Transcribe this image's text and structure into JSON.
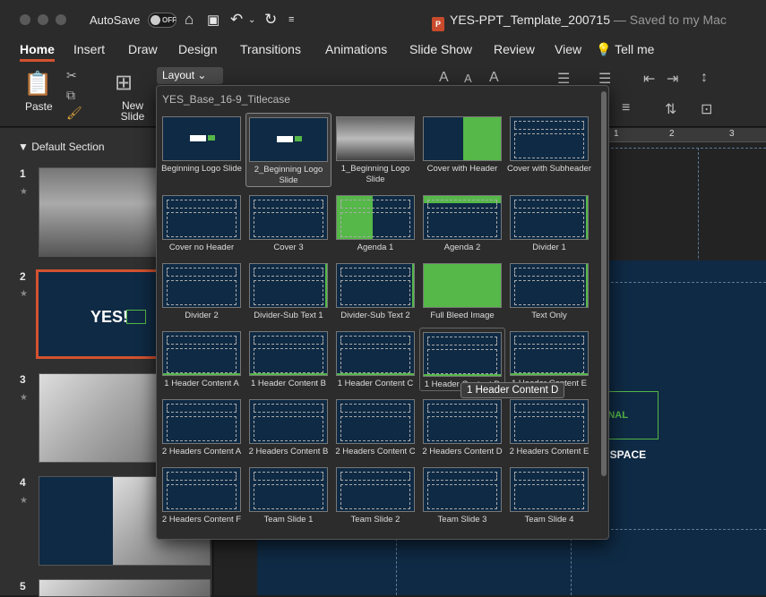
{
  "titlebar": {
    "autosave_label": "AutoSave",
    "autosave_state": "OFF",
    "doc_name": "YES-PPT_Template_200715",
    "saved_text": "— Saved to my Mac"
  },
  "tabs": [
    "Home",
    "Insert",
    "Draw",
    "Design",
    "Transitions",
    "Animations",
    "Slide Show",
    "Review",
    "View",
    "Tell me"
  ],
  "ribbon": {
    "paste_label": "Paste",
    "new_slide_label": "New Slide",
    "layout_label": "Layout"
  },
  "sidebar": {
    "section_label": "Default Section",
    "slide_numbers": [
      "1",
      "2",
      "3",
      "4",
      "5"
    ]
  },
  "ruler": {
    "ticks": [
      "1",
      "2",
      "3"
    ]
  },
  "slide_text": {
    "word1": "TIONAL",
    "word2": "T SPACE"
  },
  "gallery": {
    "title": "YES_Base_16-9_Titlecase",
    "layouts": [
      "Beginning Logo Slide",
      "2_Beginning Logo Slide",
      "1_Beginning Logo Slide",
      "Cover with Header",
      "Cover with Subheader",
      "Cover no Header",
      "Cover 3",
      "Agenda 1",
      "Agenda 2",
      "Divider 1",
      "Divider 2",
      "Divider-Sub Text 1",
      "Divider-Sub Text 2",
      "Full Bleed Image",
      "Text Only",
      "1 Header Content A",
      "1 Header Content B",
      "1 Header Content C",
      "1 Header Content D",
      "1 Header Content E",
      "2 Headers Content A",
      "2 Headers Content B",
      "2 Headers Content C",
      "2 Headers Content D",
      "2 Headers Content E",
      "2 Headers Content F",
      "Team Slide 1",
      "Team Slide 2",
      "Team Slide 3",
      "Team Slide 4"
    ],
    "tooltip": "1 Header Content D"
  },
  "colors": {
    "accent": "#d35230",
    "slide_bg": "#0f2a44",
    "brand_green": "#55b848"
  }
}
